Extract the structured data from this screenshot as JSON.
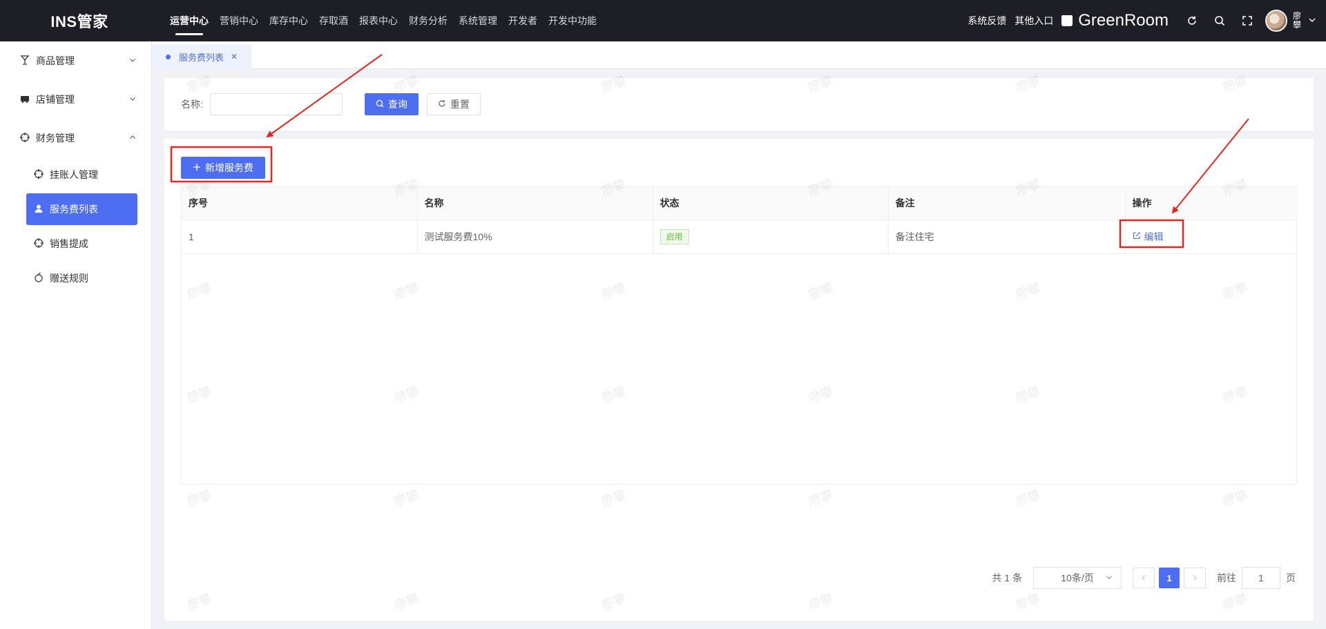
{
  "app": {
    "logo": "INS管家"
  },
  "topnav": [
    {
      "label": "运营中心",
      "active": true
    },
    {
      "label": "营销中心"
    },
    {
      "label": "库存中心"
    },
    {
      "label": "存取酒"
    },
    {
      "label": "报表中心"
    },
    {
      "label": "财务分析"
    },
    {
      "label": "系统管理"
    },
    {
      "label": "开发者"
    },
    {
      "label": "开发中功能"
    }
  ],
  "header_right": {
    "feedback": "系统反馈",
    "other_entry": "其他入口",
    "store_name": "GreenRoom",
    "user_name": "廖攀"
  },
  "sidebar": {
    "groups": [
      {
        "label": "商品管理",
        "icon": "goblet-icon",
        "expanded": false
      },
      {
        "label": "店铺管理",
        "icon": "store-icon",
        "expanded": false
      },
      {
        "label": "财务管理",
        "icon": "target-icon",
        "expanded": true
      }
    ],
    "sub_items": [
      {
        "label": "挂账人管理",
        "icon": "target-icon"
      },
      {
        "label": "服务费列表",
        "icon": "user-icon",
        "active": true
      },
      {
        "label": "销售提成",
        "icon": "target-icon"
      },
      {
        "label": "赠送规则",
        "icon": "apple-icon"
      }
    ]
  },
  "tabs": [
    {
      "label": "服务费列表",
      "active": true
    }
  ],
  "search": {
    "name_label": "名称:",
    "name_value": "",
    "query_label": "查询",
    "reset_label": "重置"
  },
  "toolbar": {
    "add_label": "新增服务费"
  },
  "table": {
    "columns": [
      "序号",
      "名称",
      "状态",
      "备注",
      "操作"
    ],
    "rows": [
      {
        "index": "1",
        "name": "测试服务费10%",
        "status": "启用",
        "remark": "备注住宅",
        "action": "编辑"
      }
    ]
  },
  "pagination": {
    "total": "共 1 条",
    "page_size": "10条/页",
    "current_page": "1",
    "goto_label": "前往",
    "goto_value": "1",
    "page_suffix": "页"
  },
  "watermark": "廖攀",
  "colors": {
    "primary": "#4e6ef2",
    "header_bg": "#1d1e26",
    "success": "#67c23a",
    "annotation": "#e8261e"
  }
}
